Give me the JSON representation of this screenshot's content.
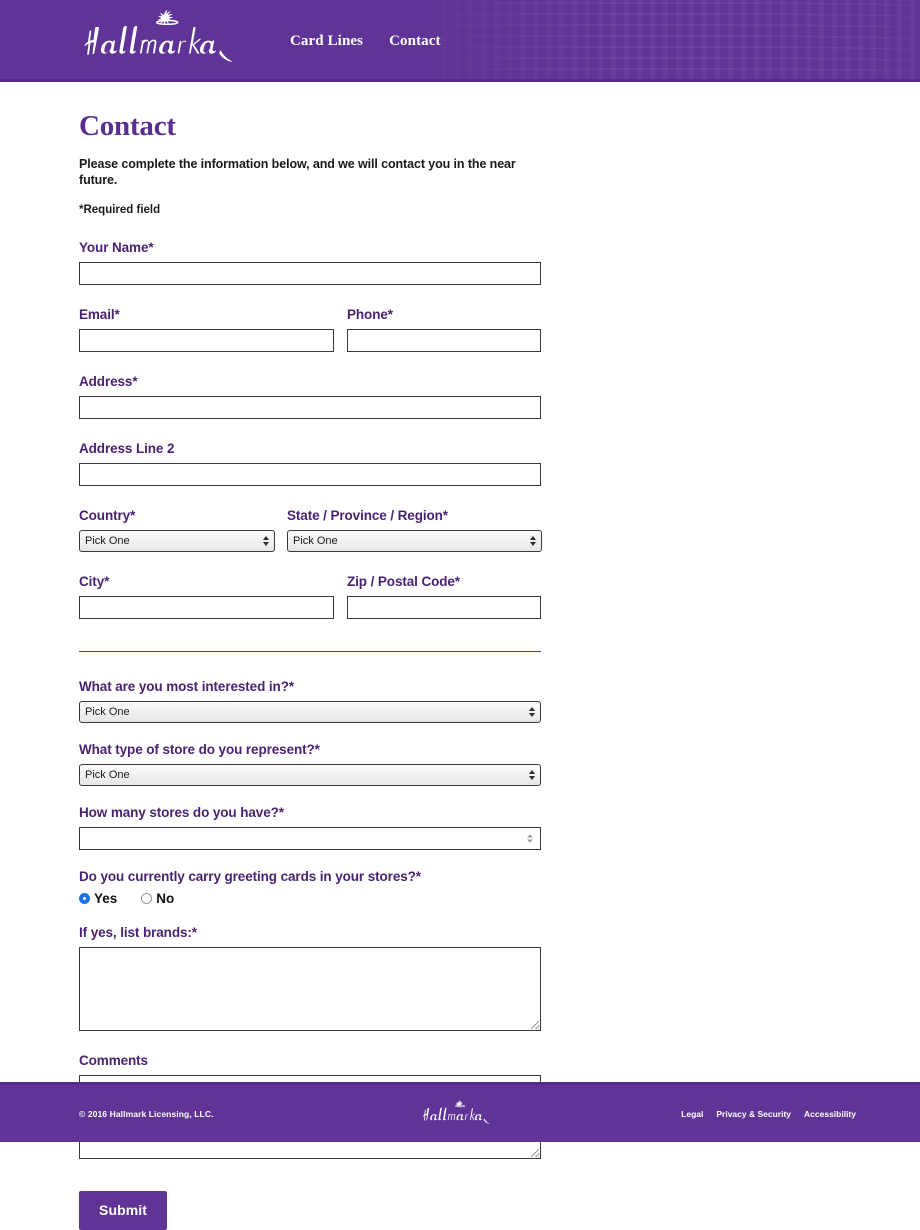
{
  "theme": {
    "brand_purple": "#5f3496",
    "heading_purple": "#5a2d91",
    "label_purple": "#4a2272",
    "radio_blue": "#1a73e8",
    "input_border": "#3a3a3a"
  },
  "header": {
    "logo_alt": "Hallmark",
    "nav": [
      {
        "label": "Card Lines"
      },
      {
        "label": "Contact"
      }
    ]
  },
  "main": {
    "title": "Contact",
    "intro": "Please complete the information below, and we will contact you in the near future.",
    "required_note": "*Required field",
    "fields": {
      "your_name": {
        "label": "Your Name*",
        "value": "",
        "placeholder": ""
      },
      "email": {
        "label": "Email*",
        "value": "",
        "placeholder": ""
      },
      "phone": {
        "label": "Phone*",
        "value": "",
        "placeholder": ""
      },
      "address": {
        "label": "Address*",
        "value": "",
        "placeholder": ""
      },
      "address_line_2": {
        "label": "Address Line 2",
        "value": "",
        "placeholder": ""
      },
      "country": {
        "label": "Country*",
        "selected": "Pick One"
      },
      "state": {
        "label": "State / Province / Region*",
        "selected": "Pick One"
      },
      "city": {
        "label": "City*",
        "value": "",
        "placeholder": ""
      },
      "zip": {
        "label": "Zip / Postal Code*",
        "value": "",
        "placeholder": ""
      },
      "interest": {
        "label": "What are you most interested in?*",
        "selected": "Pick One"
      },
      "store_type": {
        "label": "What type of store do you represent?*",
        "selected": "Pick One"
      },
      "store_count": {
        "label": "How many stores do you have?*",
        "value": "",
        "placeholder": ""
      },
      "carry_cards": {
        "label": "Do you currently carry greeting cards in your stores?*",
        "options": [
          {
            "label": "Yes",
            "checked": true
          },
          {
            "label": "No",
            "checked": false
          }
        ]
      },
      "brands": {
        "label": "If yes, list brands:*",
        "value": "",
        "placeholder": ""
      },
      "comments": {
        "label": "Comments",
        "value": "",
        "placeholder": ""
      }
    },
    "submit_label": "Submit"
  },
  "footer": {
    "copyright": "© 2016 Hallmark Licensing, LLC.",
    "logo_alt": "Hallmark",
    "links": [
      {
        "label": "Legal"
      },
      {
        "label": "Privacy & Security"
      },
      {
        "label": "Accessibility"
      }
    ]
  }
}
